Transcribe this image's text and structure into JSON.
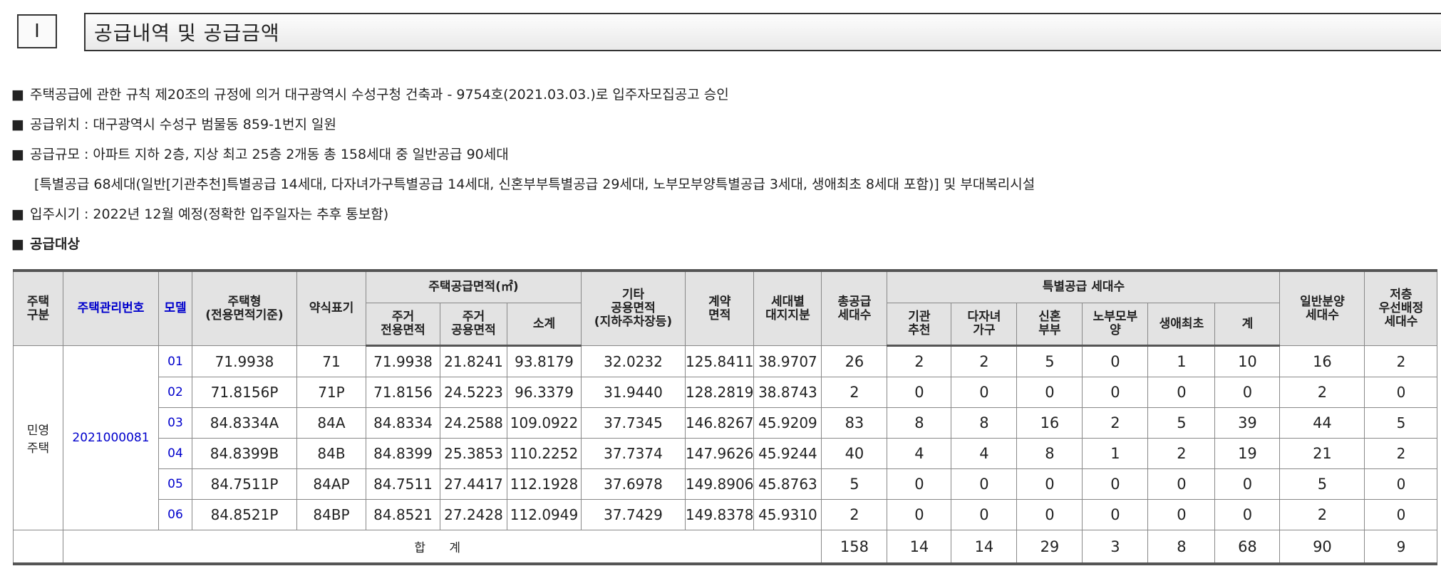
{
  "header": {
    "number": "Ⅰ",
    "title": "공급내역 및 공급금액"
  },
  "bullets": [
    {
      "mark": "■",
      "text": "주택공급에 관한 규칙 제20조의 규정에 의거 대구광역시 수성구청 건축과 - 9754호(2021.03.03.)로 입주자모집공고 승인"
    },
    {
      "mark": "■",
      "text": "공급위치 : 대구광역시 수성구 범물동 859-1번지 일원"
    },
    {
      "mark": "■",
      "text": "공급규모 : 아파트 지하 2층, 지상 최고 25층 2개동 총 158세대 중 일반공급 90세대"
    },
    {
      "mark": "",
      "text": "[특별공급 68세대(일반[기관추천]특별공급 14세대, 다자녀가구특별공급 14세대, 신혼부부특별공급 29세대, 노부모부양특별공급 3세대, 생애최초 8세대 포함)] 및 부대복리시설"
    },
    {
      "mark": "■",
      "text": "입주시기 : 2022년 12월 예정(정확한 입주일자는 추후 통보함)"
    },
    {
      "mark": "■",
      "text": "공급대상"
    }
  ],
  "table": {
    "headers": {
      "type": "주택\n구분",
      "mgmt": "주택관리번호",
      "model": "모델",
      "house_type": "주택형\n(전용면적기준)",
      "abbr": "약식표기",
      "area_group": "주택공급면적(㎡)",
      "exclusive": "주거\n전용면적",
      "common": "주거\n공용면적",
      "subtotal": "소계",
      "other": "기타\n공용면적\n(지하주차장등)",
      "contract": "계약\n면적",
      "land": "세대별\n대지지분",
      "total_units": "총공급\n세대수",
      "special_group": "특별공급 세대수",
      "inst": "기관\n추천",
      "multi": "다자녀\n가구",
      "newlywed": "신혼\n부부",
      "elderly": "노부모부\n양",
      "first": "생애최초",
      "sp_sum": "계",
      "general": "일반분양\n세대수",
      "low_floor": "저층\n우선배정\n세대수"
    },
    "house_kind": "민영\n주택",
    "mgmt_no": "2021000081",
    "rows": [
      {
        "model": "01",
        "type": "71.9938",
        "abbr": "71",
        "excl": "71.9938",
        "comm": "21.8241",
        "sub": "93.8179",
        "other": "32.0232",
        "contract": "125.8411",
        "land": "38.9707",
        "total": "26",
        "inst": "2",
        "multi": "2",
        "newly": "5",
        "elder": "0",
        "first": "1",
        "sum": "10",
        "general": "16",
        "low": "2"
      },
      {
        "model": "02",
        "type": "71.8156P",
        "abbr": "71P",
        "excl": "71.8156",
        "comm": "24.5223",
        "sub": "96.3379",
        "other": "31.9440",
        "contract": "128.2819",
        "land": "38.8743",
        "total": "2",
        "inst": "0",
        "multi": "0",
        "newly": "0",
        "elder": "0",
        "first": "0",
        "sum": "0",
        "general": "2",
        "low": "0"
      },
      {
        "model": "03",
        "type": "84.8334A",
        "abbr": "84A",
        "excl": "84.8334",
        "comm": "24.2588",
        "sub": "109.0922",
        "other": "37.7345",
        "contract": "146.8267",
        "land": "45.9209",
        "total": "83",
        "inst": "8",
        "multi": "8",
        "newly": "16",
        "elder": "2",
        "first": "5",
        "sum": "39",
        "general": "44",
        "low": "5"
      },
      {
        "model": "04",
        "type": "84.8399B",
        "abbr": "84B",
        "excl": "84.8399",
        "comm": "25.3853",
        "sub": "110.2252",
        "other": "37.7374",
        "contract": "147.9626",
        "land": "45.9244",
        "total": "40",
        "inst": "4",
        "multi": "4",
        "newly": "8",
        "elder": "1",
        "first": "2",
        "sum": "19",
        "general": "21",
        "low": "2"
      },
      {
        "model": "05",
        "type": "84.7511P",
        "abbr": "84AP",
        "excl": "84.7511",
        "comm": "27.4417",
        "sub": "112.1928",
        "other": "37.6978",
        "contract": "149.8906",
        "land": "45.8763",
        "total": "5",
        "inst": "0",
        "multi": "0",
        "newly": "0",
        "elder": "0",
        "first": "0",
        "sum": "0",
        "general": "5",
        "low": "0"
      },
      {
        "model": "06",
        "type": "84.8521P",
        "abbr": "84BP",
        "excl": "84.8521",
        "comm": "27.2428",
        "sub": "112.0949",
        "other": "37.7429",
        "contract": "149.8378",
        "land": "45.9310",
        "total": "2",
        "inst": "0",
        "multi": "0",
        "newly": "0",
        "elder": "0",
        "first": "0",
        "sum": "0",
        "general": "2",
        "low": "0"
      }
    ],
    "total": {
      "label": "합 계",
      "total": "158",
      "inst": "14",
      "multi": "14",
      "newly": "29",
      "elder": "3",
      "first": "8",
      "sum": "68",
      "general": "90",
      "low": "9"
    }
  }
}
